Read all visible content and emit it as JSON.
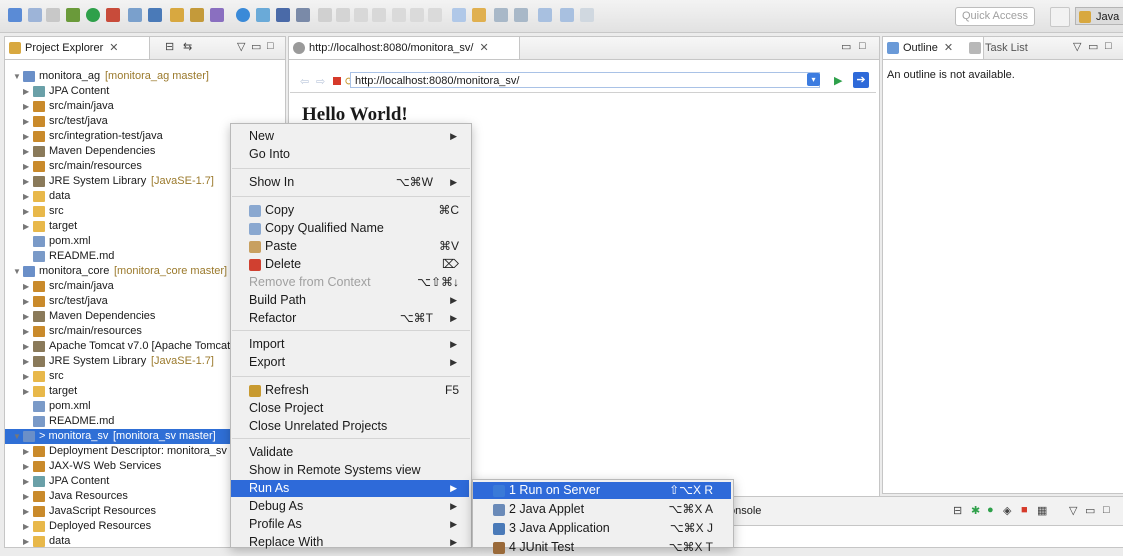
{
  "toolbar": {
    "quick_access_placeholder": "Quick Access",
    "perspective_label": "Java EE"
  },
  "project_explorer": {
    "tab_label": "Project Explorer",
    "items": [
      {
        "label": "monitora_ag",
        "suffix": "[monitora_ag master]",
        "expanded": true
      },
      {
        "label": "JPA Content"
      },
      {
        "label": "src/main/java"
      },
      {
        "label": "src/test/java"
      },
      {
        "label": "src/integration-test/java"
      },
      {
        "label": "Maven Dependencies"
      },
      {
        "label": "src/main/resources"
      },
      {
        "label": "JRE System Library",
        "suffix": "[JavaSE-1.7]"
      },
      {
        "label": "data"
      },
      {
        "label": "src"
      },
      {
        "label": "target"
      },
      {
        "label": "pom.xml"
      },
      {
        "label": "README.md"
      },
      {
        "label": "monitora_core",
        "suffix": "[monitora_core master]",
        "expanded": true
      },
      {
        "label": "src/main/java"
      },
      {
        "label": "src/test/java"
      },
      {
        "label": "Maven Dependencies"
      },
      {
        "label": "src/main/resources"
      },
      {
        "label": "Apache Tomcat v7.0 [Apache Tomcat"
      },
      {
        "label": "JRE System Library",
        "suffix": "[JavaSE-1.7]"
      },
      {
        "label": "src"
      },
      {
        "label": "target"
      },
      {
        "label": "pom.xml"
      },
      {
        "label": "README.md"
      },
      {
        "label": "> monitora_sv",
        "suffix": "[monitora_sv master]",
        "selected": true
      },
      {
        "label": "Deployment Descriptor: monitora_sv"
      },
      {
        "label": "JAX-WS Web Services"
      },
      {
        "label": "JPA Content"
      },
      {
        "label": "Java Resources"
      },
      {
        "label": "JavaScript Resources"
      },
      {
        "label": "Deployed Resources"
      },
      {
        "label": "data"
      }
    ]
  },
  "browser": {
    "tab_label": "http://localhost:8080/monitora_sv/",
    "url": "http://localhost:8080/monitora_sv/",
    "content_heading": "Hello World!"
  },
  "outline": {
    "tab_label": "Outline",
    "tab2_label": "Task List",
    "message": "An outline is not available."
  },
  "bottom_panel": {
    "tab_fragment": "onsole"
  },
  "context_menu": {
    "items": [
      {
        "label": "New",
        "submenu": true
      },
      {
        "label": "Go Into"
      },
      {
        "label": "Show In",
        "shortcut": "⌥⌘W",
        "submenu": true
      },
      {
        "label": "Copy",
        "shortcut": "⌘C",
        "icon": "copy-icon"
      },
      {
        "label": "Copy Qualified Name",
        "icon": "copy-icon"
      },
      {
        "label": "Paste",
        "shortcut": "⌘V",
        "icon": "paste-icon"
      },
      {
        "label": "Delete",
        "shortcut": "⌦",
        "icon": "delete-icon"
      },
      {
        "label": "Remove from Context",
        "shortcut": "⌥⇧⌘↓",
        "disabled": true
      },
      {
        "label": "Build Path",
        "submenu": true
      },
      {
        "label": "Refactor",
        "shortcut": "⌥⌘T",
        "submenu": true
      },
      {
        "label": "Import",
        "submenu": true
      },
      {
        "label": "Export",
        "submenu": true
      },
      {
        "label": "Refresh",
        "shortcut": "F5",
        "icon": "refresh-icon"
      },
      {
        "label": "Close Project"
      },
      {
        "label": "Close Unrelated Projects"
      },
      {
        "label": "Validate"
      },
      {
        "label": "Show in Remote Systems view"
      },
      {
        "label": "Run As",
        "submenu": true,
        "highlighted": true
      },
      {
        "label": "Debug As",
        "submenu": true
      },
      {
        "label": "Profile As",
        "submenu": true
      },
      {
        "label": "Replace With",
        "submenu": true
      }
    ]
  },
  "run_as_submenu": {
    "items": [
      {
        "label": "1 Run on Server",
        "shortcut": "⇧⌥X R",
        "highlighted": true
      },
      {
        "label": "2 Java Applet",
        "shortcut": "⌥⌘X A"
      },
      {
        "label": "3 Java Application",
        "shortcut": "⌥⌘X J"
      },
      {
        "label": "4 JUnit Test",
        "shortcut": "⌥⌘X T"
      }
    ]
  },
  "colors": {
    "selection": "#2f6fd6",
    "menu_highlight": "#2e6ad9",
    "folder": "#e8b84a",
    "package": "#c98a2b"
  }
}
